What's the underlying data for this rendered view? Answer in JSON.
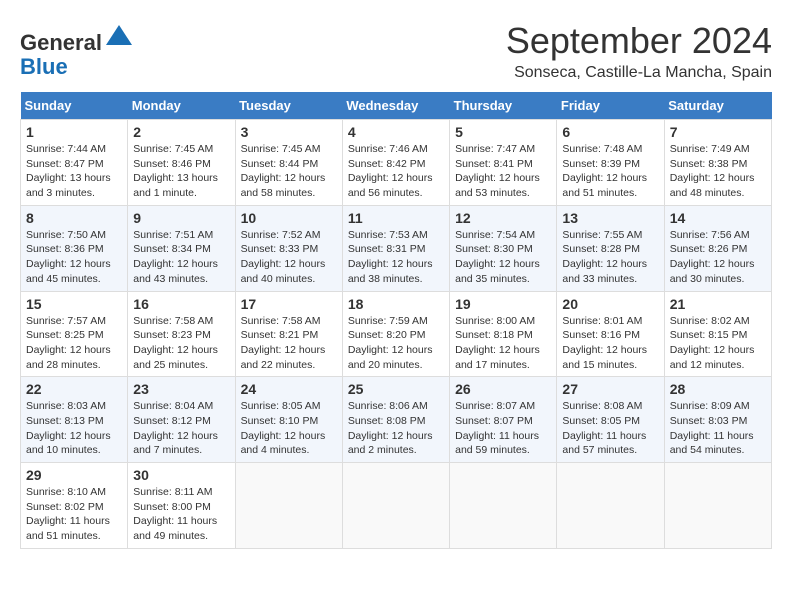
{
  "logo": {
    "line1": "General",
    "line2": "Blue"
  },
  "title": "September 2024",
  "location": "Sonseca, Castille-La Mancha, Spain",
  "days_of_week": [
    "Sunday",
    "Monday",
    "Tuesday",
    "Wednesday",
    "Thursday",
    "Friday",
    "Saturday"
  ],
  "weeks": [
    [
      {
        "day": "1",
        "info": "Sunrise: 7:44 AM\nSunset: 8:47 PM\nDaylight: 13 hours and 3 minutes."
      },
      {
        "day": "2",
        "info": "Sunrise: 7:45 AM\nSunset: 8:46 PM\nDaylight: 13 hours and 1 minute."
      },
      {
        "day": "3",
        "info": "Sunrise: 7:45 AM\nSunset: 8:44 PM\nDaylight: 12 hours and 58 minutes."
      },
      {
        "day": "4",
        "info": "Sunrise: 7:46 AM\nSunset: 8:42 PM\nDaylight: 12 hours and 56 minutes."
      },
      {
        "day": "5",
        "info": "Sunrise: 7:47 AM\nSunset: 8:41 PM\nDaylight: 12 hours and 53 minutes."
      },
      {
        "day": "6",
        "info": "Sunrise: 7:48 AM\nSunset: 8:39 PM\nDaylight: 12 hours and 51 minutes."
      },
      {
        "day": "7",
        "info": "Sunrise: 7:49 AM\nSunset: 8:38 PM\nDaylight: 12 hours and 48 minutes."
      }
    ],
    [
      {
        "day": "8",
        "info": "Sunrise: 7:50 AM\nSunset: 8:36 PM\nDaylight: 12 hours and 45 minutes."
      },
      {
        "day": "9",
        "info": "Sunrise: 7:51 AM\nSunset: 8:34 PM\nDaylight: 12 hours and 43 minutes."
      },
      {
        "day": "10",
        "info": "Sunrise: 7:52 AM\nSunset: 8:33 PM\nDaylight: 12 hours and 40 minutes."
      },
      {
        "day": "11",
        "info": "Sunrise: 7:53 AM\nSunset: 8:31 PM\nDaylight: 12 hours and 38 minutes."
      },
      {
        "day": "12",
        "info": "Sunrise: 7:54 AM\nSunset: 8:30 PM\nDaylight: 12 hours and 35 minutes."
      },
      {
        "day": "13",
        "info": "Sunrise: 7:55 AM\nSunset: 8:28 PM\nDaylight: 12 hours and 33 minutes."
      },
      {
        "day": "14",
        "info": "Sunrise: 7:56 AM\nSunset: 8:26 PM\nDaylight: 12 hours and 30 minutes."
      }
    ],
    [
      {
        "day": "15",
        "info": "Sunrise: 7:57 AM\nSunset: 8:25 PM\nDaylight: 12 hours and 28 minutes."
      },
      {
        "day": "16",
        "info": "Sunrise: 7:58 AM\nSunset: 8:23 PM\nDaylight: 12 hours and 25 minutes."
      },
      {
        "day": "17",
        "info": "Sunrise: 7:58 AM\nSunset: 8:21 PM\nDaylight: 12 hours and 22 minutes."
      },
      {
        "day": "18",
        "info": "Sunrise: 7:59 AM\nSunset: 8:20 PM\nDaylight: 12 hours and 20 minutes."
      },
      {
        "day": "19",
        "info": "Sunrise: 8:00 AM\nSunset: 8:18 PM\nDaylight: 12 hours and 17 minutes."
      },
      {
        "day": "20",
        "info": "Sunrise: 8:01 AM\nSunset: 8:16 PM\nDaylight: 12 hours and 15 minutes."
      },
      {
        "day": "21",
        "info": "Sunrise: 8:02 AM\nSunset: 8:15 PM\nDaylight: 12 hours and 12 minutes."
      }
    ],
    [
      {
        "day": "22",
        "info": "Sunrise: 8:03 AM\nSunset: 8:13 PM\nDaylight: 12 hours and 10 minutes."
      },
      {
        "day": "23",
        "info": "Sunrise: 8:04 AM\nSunset: 8:12 PM\nDaylight: 12 hours and 7 minutes."
      },
      {
        "day": "24",
        "info": "Sunrise: 8:05 AM\nSunset: 8:10 PM\nDaylight: 12 hours and 4 minutes."
      },
      {
        "day": "25",
        "info": "Sunrise: 8:06 AM\nSunset: 8:08 PM\nDaylight: 12 hours and 2 minutes."
      },
      {
        "day": "26",
        "info": "Sunrise: 8:07 AM\nSunset: 8:07 PM\nDaylight: 11 hours and 59 minutes."
      },
      {
        "day": "27",
        "info": "Sunrise: 8:08 AM\nSunset: 8:05 PM\nDaylight: 11 hours and 57 minutes."
      },
      {
        "day": "28",
        "info": "Sunrise: 8:09 AM\nSunset: 8:03 PM\nDaylight: 11 hours and 54 minutes."
      }
    ],
    [
      {
        "day": "29",
        "info": "Sunrise: 8:10 AM\nSunset: 8:02 PM\nDaylight: 11 hours and 51 minutes."
      },
      {
        "day": "30",
        "info": "Sunrise: 8:11 AM\nSunset: 8:00 PM\nDaylight: 11 hours and 49 minutes."
      },
      {
        "day": "",
        "info": ""
      },
      {
        "day": "",
        "info": ""
      },
      {
        "day": "",
        "info": ""
      },
      {
        "day": "",
        "info": ""
      },
      {
        "day": "",
        "info": ""
      }
    ]
  ]
}
